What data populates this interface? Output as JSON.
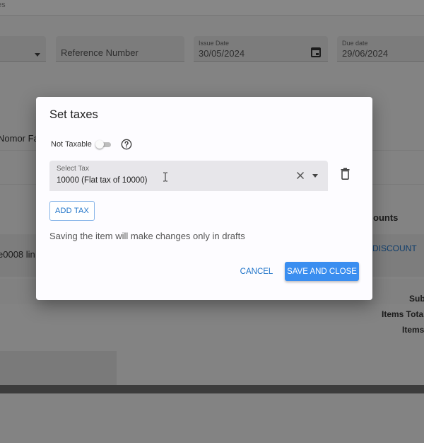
{
  "background": {
    "topbar_text": "es",
    "reference_placeholder": "Reference Number",
    "issue_date": {
      "label": "Issue Date",
      "value": "30/05/2024"
    },
    "due_date": {
      "label": "Due date",
      "value": "29/06/2024"
    },
    "customer_fragment": "Nomor Fa",
    "amounts_header": "ounts",
    "item_fragment": "e0008 lin",
    "discount_link": "DISCOUNT",
    "totals": [
      "Sub",
      "Items Total",
      "Items"
    ]
  },
  "dialog": {
    "title": "Set taxes",
    "not_taxable_label": "Not Taxable",
    "not_taxable_on": false,
    "select_tax": {
      "label": "Select Tax",
      "value": "10000 (Flat tax of 10000)"
    },
    "add_tax_label": "ADD TAX",
    "notice": "Saving the item will make changes only in drafts",
    "cancel_label": "CANCEL",
    "save_label": "SAVE AND CLOSE"
  },
  "icons": {
    "help": "help-circle-icon",
    "clear": "close-icon",
    "dropdown": "caret-down-icon",
    "delete": "trash-icon",
    "calendar": "calendar-icon"
  },
  "colors": {
    "accent": "#3a8ef0",
    "link": "#1e73c8",
    "scrim": "#000000"
  }
}
